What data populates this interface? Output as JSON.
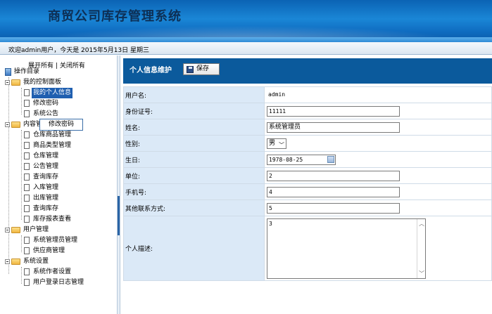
{
  "header": {
    "title": "商贸公司库存管理系统"
  },
  "welcome": {
    "text": "欢迎admin用户，今天是 2015年5月13日 星期三"
  },
  "sidebar": {
    "expand_all": "展开所有",
    "separator": "|",
    "collapse_all": "关闭所有",
    "root": "操作目录",
    "groups": [
      {
        "label": "我的控制面板",
        "items": [
          "我的个人信息",
          "修改密码",
          "系统公告"
        ]
      },
      {
        "label": "内容管理",
        "items": [
          "仓库商品管理",
          "商品类型管理",
          "仓库管理",
          "公告管理",
          "查询库存",
          "入库管理",
          "出库管理",
          "查询库存",
          "库存报表查看"
        ]
      },
      {
        "label": "用户管理",
        "items": [
          "系统管理员管理",
          "供应商管理"
        ]
      },
      {
        "label": "系统设置",
        "items": [
          "系统作者设置",
          "用户登录日志管理"
        ]
      }
    ],
    "selected": "我的个人信息",
    "tooltip": "修改密码",
    "group2_visible_label": "内容管"
  },
  "main": {
    "title": "个人信息维护",
    "save_label": "保存",
    "fields": {
      "username_label": "用户名:",
      "username_value": "admin",
      "idcard_label": "身份证号:",
      "idcard_value": "11111",
      "name_label": "姓名:",
      "name_value": "系统管理员",
      "gender_label": "性别:",
      "gender_value": "男",
      "birthday_label": "生日:",
      "birthday_value": "1978-08-25",
      "unit_label": "单位:",
      "unit_value": "2",
      "phone_label": "手机号:",
      "phone_value": "4",
      "other_label": "其他联系方式:",
      "other_value": "5",
      "desc_label": "个人描述:",
      "desc_value": "3"
    }
  },
  "colors": {
    "banner": "#0b63b4",
    "panel_header": "#0b5a9c",
    "label_bg": "#dbe9f7",
    "selected": "#1f5fb0"
  }
}
